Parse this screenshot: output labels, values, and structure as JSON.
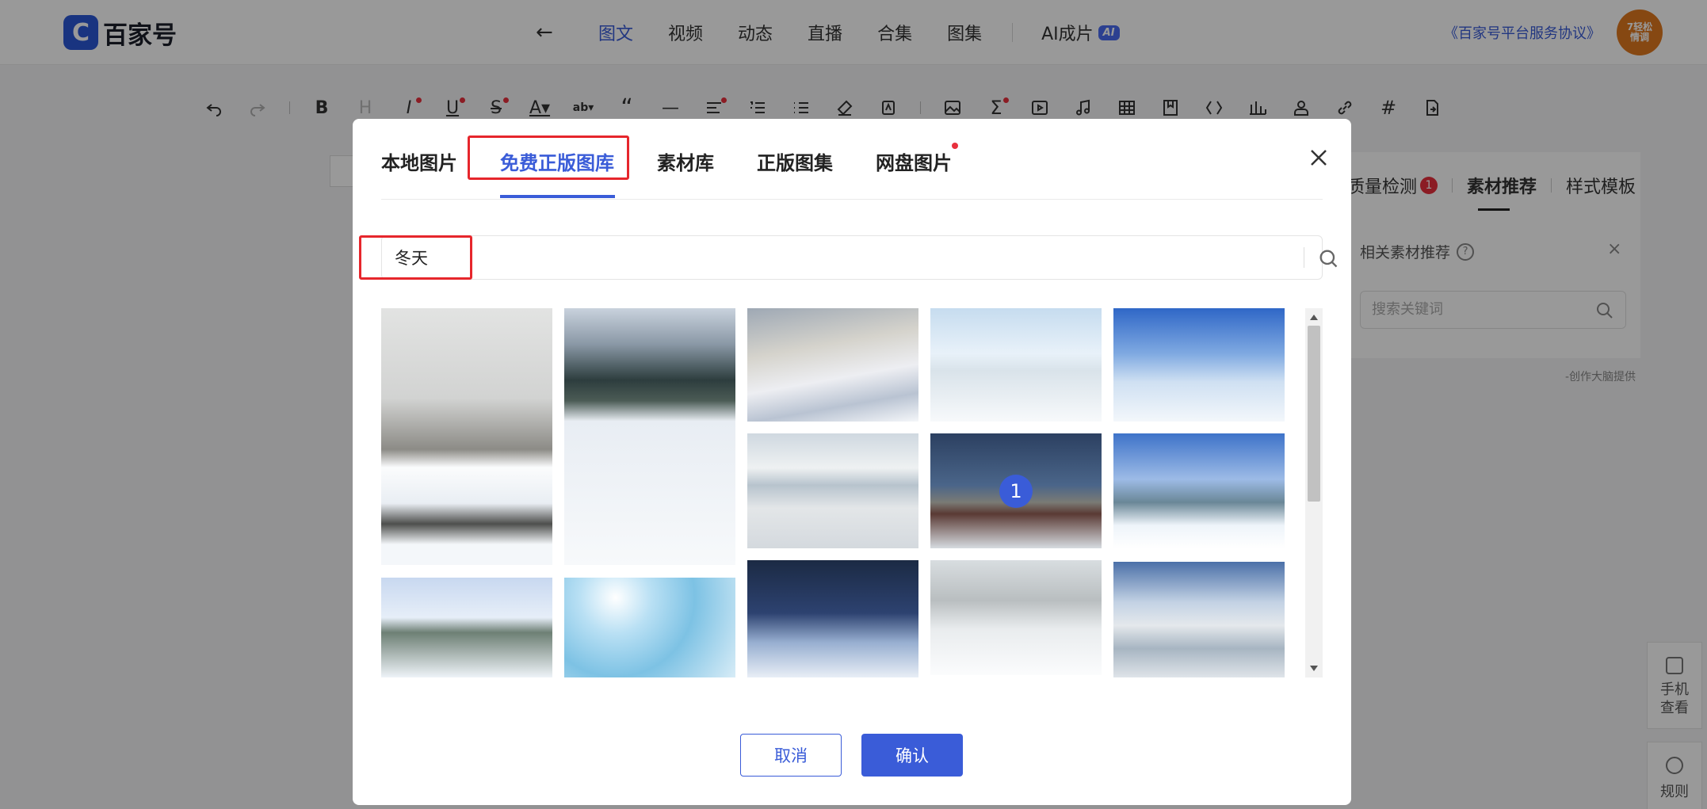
{
  "header": {
    "brand": "百家号",
    "back_icon": "arrow-left-icon",
    "nav_tabs": [
      "图文",
      "视频",
      "动态",
      "直播",
      "合集",
      "图集"
    ],
    "active_tab": "图文",
    "ai_tab": {
      "label": "AI成片",
      "badge": "AI"
    },
    "agreement_link": "《百家号平台服务协议》",
    "avatar_text": "7轻松\n情调"
  },
  "toolbar": {
    "icons": [
      "undo-icon",
      "redo-icon",
      "bold-icon",
      "heading-icon",
      "italic-icon",
      "underline-icon",
      "strikethrough-icon",
      "font-color-icon",
      "highlight-icon",
      "quote-icon",
      "divider-icon",
      "align-icon",
      "ordered-list-icon",
      "unordered-list-icon",
      "eraser-icon",
      "format-painter-icon",
      "image-icon",
      "formula-icon",
      "video-icon",
      "audio-icon",
      "table-icon",
      "bookmark-icon",
      "code-icon",
      "chart-icon",
      "profile-card-icon",
      "link-icon",
      "hashtag-icon",
      "doc-import-icon"
    ]
  },
  "side_panel": {
    "tabs": [
      {
        "label": "质量检测",
        "badge": "1"
      },
      {
        "label": "素材推荐"
      },
      {
        "label": "样式模板"
      }
    ],
    "active_tab": "素材推荐",
    "recommend_label": "相关素材推荐",
    "search_placeholder": "搜索关键词",
    "credit": "-创作大脑提供",
    "float_buttons": [
      {
        "label": "手机\n查看",
        "icon": "phone-icon"
      },
      {
        "label": "规则",
        "icon": "info-icon"
      }
    ]
  },
  "modal": {
    "tabs": [
      "本地图片",
      "免费正版图库",
      "素材库",
      "正版图集",
      "网盘图片"
    ],
    "active_tab": "免费正版图库",
    "search_value": "冬天",
    "selected_number": "1",
    "cancel_label": "取消",
    "confirm_label": "确认",
    "colors": {
      "accent": "#3a5cd8",
      "highlight_box": "#e6262c"
    }
  }
}
